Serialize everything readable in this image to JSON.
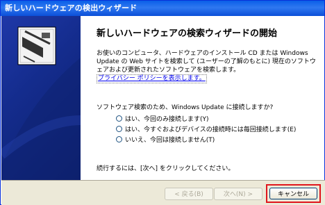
{
  "window": {
    "title": "新しいハードウェアの検出ウィザード"
  },
  "heading": "新しいハードウェアの検索ウィザードの開始",
  "intro": {
    "line1": "お使いのコンピュータ、ハードウェアのインストール CD または Windows",
    "line2": "Update の Web サイトを検索して (ユーザーの了解のもとに) 現在のソフトウ",
    "line3": "ェアおよび更新されたソフトウェアを検索します。",
    "privacy_link": "プライバシー ポリシーを表示します。"
  },
  "question": "ソフトウェア検索のため、Windows Update に接続しますか?",
  "options": [
    {
      "label": "はい、今回のみ接続します(Y)"
    },
    {
      "label": "はい、今すぐおよびデバイスの接続時には毎回接続します(E)"
    },
    {
      "label": "いいえ、今回は接続しません(T)"
    }
  ],
  "continue_text": "続行するには、[次へ] をクリックしてください。",
  "buttons": {
    "back": "< 戻る(B)",
    "next": "次へ(N) >",
    "cancel": "キャンセル"
  },
  "colors": {
    "title_bar": "#0a5fe8",
    "left_panel": "#142c8d",
    "cancel_highlight": "#e0161d"
  }
}
